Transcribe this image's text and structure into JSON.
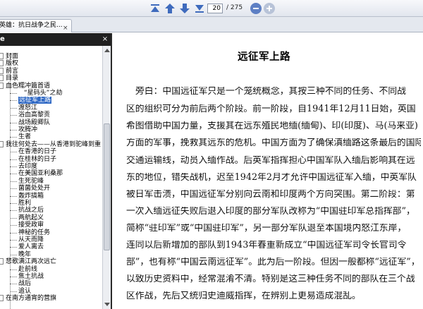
{
  "toolbar": {
    "buttons": [
      {
        "name": "first-page-button",
        "icon": "first-page-icon"
      },
      {
        "name": "previous-page-button",
        "icon": "arrow-up-icon"
      },
      {
        "name": "next-page-button",
        "icon": "arrow-down-icon"
      },
      {
        "name": "last-page-button",
        "icon": "last-page-icon"
      }
    ],
    "page_current": "20",
    "page_total": "/ 275",
    "zoom_out_icon": "zoom-out-icon",
    "zoom_in_icon": "zoom-in-icon",
    "accent": "#4a6fb5"
  },
  "tab": {
    "label": "英雄：抗日战争之民...",
    "close": "×"
  },
  "sidebar": {
    "header": "e",
    "close": "×",
    "items": [
      {
        "label": "封面"
      },
      {
        "label": "版权"
      },
      {
        "label": "前言"
      },
      {
        "label": "目录"
      },
      {
        "label": "血色糯冲篇首语"
      },
      {
        "label": "“星码头”之劫"
      },
      {
        "label": "远征军上路",
        "selected": true
      },
      {
        "label": "渡怒江"
      },
      {
        "label": "浴血高黎贡"
      },
      {
        "label": "战场殿卿队"
      },
      {
        "label": "攻腾冲"
      },
      {
        "label": "生者"
      },
      {
        "label": "我往何处去——从香港到驼峰到重"
      },
      {
        "label": "在香港的日子"
      },
      {
        "label": "在桂林的日子"
      },
      {
        "label": "去印度"
      },
      {
        "label": "在美国亚利桑那"
      },
      {
        "label": "生死驼峰"
      },
      {
        "label": "菌菌处处开"
      },
      {
        "label": "轰炸搞箱"
      },
      {
        "label": "胜利"
      },
      {
        "label": "抗战之后"
      },
      {
        "label": "两航起义"
      },
      {
        "label": "接受政审"
      },
      {
        "label": "神秘的任务"
      },
      {
        "label": "从天而降"
      },
      {
        "label": "爱人离去"
      },
      {
        "label": "晚年"
      },
      {
        "label": "悲歌满江两次远亡"
      },
      {
        "label": "赴前线"
      },
      {
        "label": "焦土抗战"
      },
      {
        "label": "战后"
      },
      {
        "label": "追认"
      },
      {
        "label": "在南方通宵的营旗"
      }
    ]
  },
  "document": {
    "title": "远征军上路",
    "lines": [
      "旁白：中国远征军只是一个笼统概念，其按三种不同的任务、不同战",
      "区的组织可分为前后两个阶段。前一阶段，自1941年12月11日始，英国",
      "希图借助中国力量，支援其在远东殖民地缅(缅甸)、印(印度)、马(马来亚)",
      "方面的军事，挽救其远东的危机。中国方面为了确保滇缅路这条最后的国际",
      "交通运输线，动员入缅作战。后英军指挥担心中国军队入缅后影响其在远",
      "东的地位，错失战机，迟至1942年2月才允许中国远征军入缅，中英军队",
      "被日军击溃，中国远征军分别向云南和印度两个方向突围。第二阶段：第",
      "一次入缅远征失败后退入印度的部分军队改称为“中国驻印军总指挥部”，",
      "简称“驻印军”或“中国驻印军”，另一部分军队退至本国境内怒江东岸，",
      "连同以后新增加的部队到1943年春重新成立“中国远征军司令长官司令",
      "部”，也有称“中国云南远征军”。此为后一阶段。但因一般都称“远征军”，",
      "以致历史资料中，经常混淆不清。特别是这三种任务不同的部队在三个战",
      "区作战，先后又统归史迪威指挥，在辨别上更易造成混乱。"
    ]
  }
}
